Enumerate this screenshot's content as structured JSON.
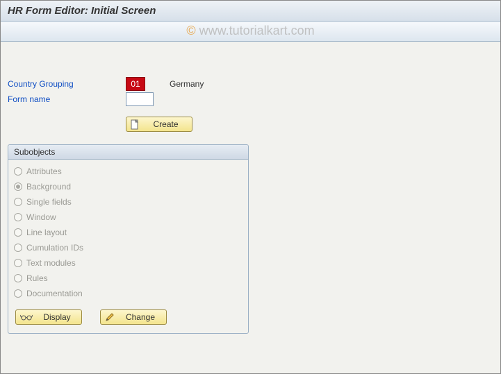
{
  "title": "HR Form Editor: Initial Screen",
  "watermark": {
    "copy": "©",
    "text": " www.tutorialkart.com"
  },
  "form": {
    "country_label": "Country Grouping",
    "country_value": "01",
    "country_text": "Germany",
    "formname_label": "Form name",
    "formname_value": ""
  },
  "buttons": {
    "create": "Create",
    "display": "Display",
    "change": "Change"
  },
  "subobjects": {
    "title": "Subobjects",
    "items": [
      {
        "label": "Attributes",
        "selected": false
      },
      {
        "label": "Background",
        "selected": true
      },
      {
        "label": "Single fields",
        "selected": false
      },
      {
        "label": "Window",
        "selected": false
      },
      {
        "label": "Line layout",
        "selected": false
      },
      {
        "label": "Cumulation IDs",
        "selected": false
      },
      {
        "label": "Text modules",
        "selected": false
      },
      {
        "label": "Rules",
        "selected": false
      },
      {
        "label": "Documentation",
        "selected": false
      }
    ]
  }
}
